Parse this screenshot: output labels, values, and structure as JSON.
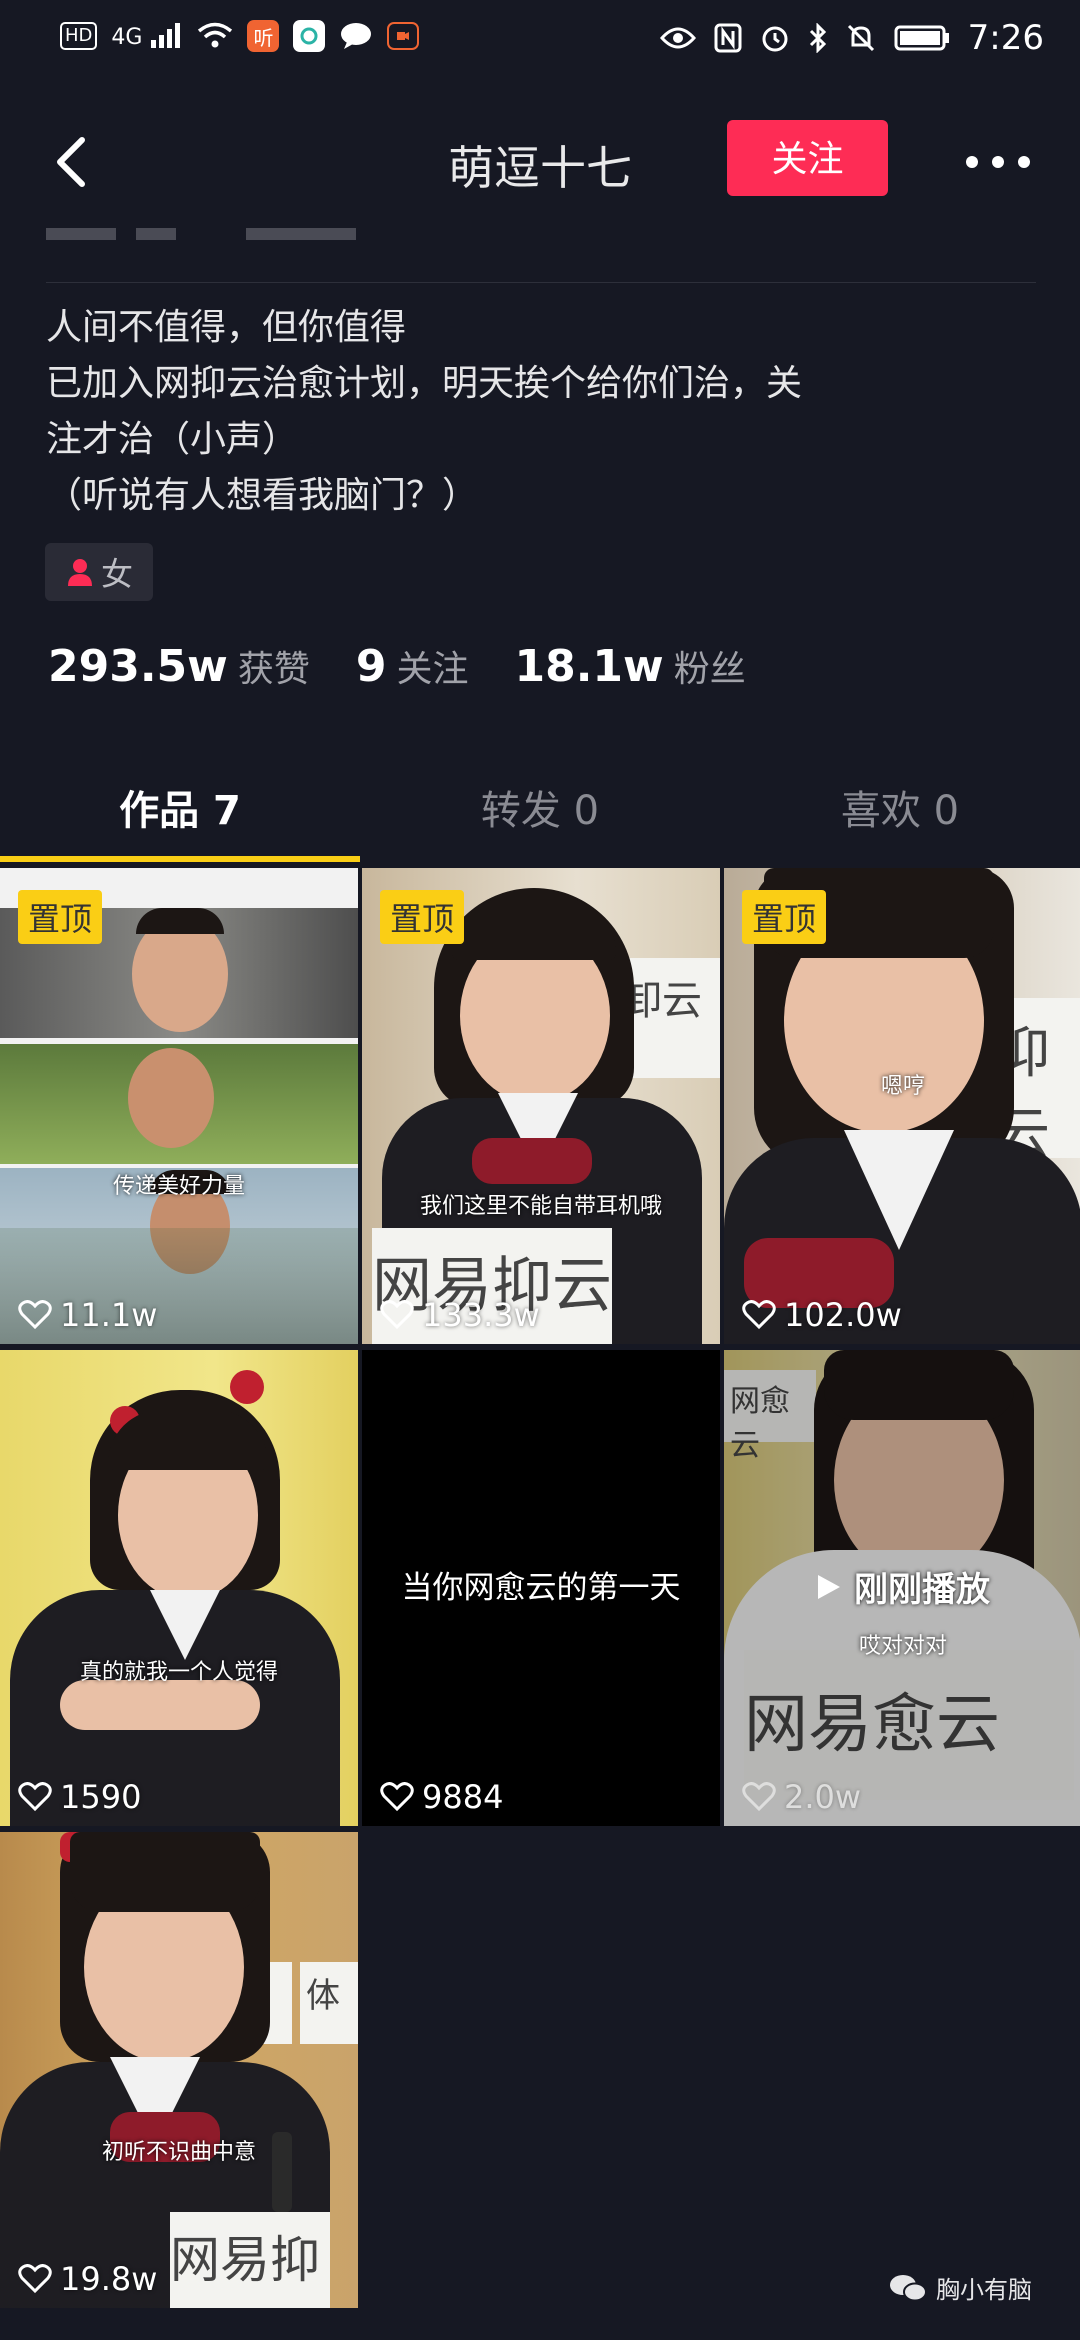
{
  "status_bar": {
    "left_icons": [
      "hd-icon",
      "4g-signal-icon",
      "wifi-icon",
      "ting-app-icon",
      "refresh-app-icon",
      "chat-app-icon",
      "video-app-icon"
    ],
    "badges": {
      "hd": "HD",
      "net": "4G",
      "ting": "听"
    },
    "right_icons": [
      "eye-icon",
      "nfc-icon",
      "alarm-icon",
      "bluetooth-icon",
      "mute-bell-icon",
      "battery-icon"
    ],
    "time": "7:26"
  },
  "header": {
    "title": "萌逗十七",
    "follow_label": "关注"
  },
  "profile": {
    "bio": [
      "人间不值得，但你值得",
      "已加入网抑云治愈计划，明天挨个给你们治，关",
      "注才治（小声）",
      "（听说有人想看我脑门？）"
    ],
    "gender_label": "女",
    "stats": [
      {
        "value": "293.5w",
        "label": "获赞"
      },
      {
        "value": "9",
        "label": "关注"
      },
      {
        "value": "18.1w",
        "label": "粉丝"
      }
    ]
  },
  "tabs": [
    {
      "label": "作品 7",
      "active": true
    },
    {
      "label": "转发 0",
      "active": false
    },
    {
      "label": "喜欢 0",
      "active": false
    }
  ],
  "videos": [
    {
      "pinned": true,
      "pin_label": "置顶",
      "caption": "传递美好力量",
      "likes": "11.1w"
    },
    {
      "pinned": true,
      "pin_label": "置顶",
      "caption": "我们这里不能自带耳机哦",
      "sign": "网易抑云",
      "likes": "133.3w"
    },
    {
      "pinned": true,
      "pin_label": "置顶",
      "caption": "嗯哼",
      "likes": "102.0w"
    },
    {
      "pinned": false,
      "caption": "真的就我一个人觉得",
      "likes": "1590"
    },
    {
      "pinned": false,
      "title_text": "当你网愈云的第一天",
      "likes": "9884"
    },
    {
      "pinned": false,
      "caption": "哎对对对",
      "replay_label": "刚刚播放",
      "sign": "网易愈云",
      "likes": "2.0w"
    },
    {
      "pinned": false,
      "caption": "初听不识曲中意",
      "sign": "网易抑",
      "likes": "19.8w"
    }
  ],
  "watermark": "胸小有脑",
  "colors": {
    "background": "#161823",
    "accent": "#fe2c55",
    "tab_indicator": "#face15",
    "pin": "#face15"
  }
}
